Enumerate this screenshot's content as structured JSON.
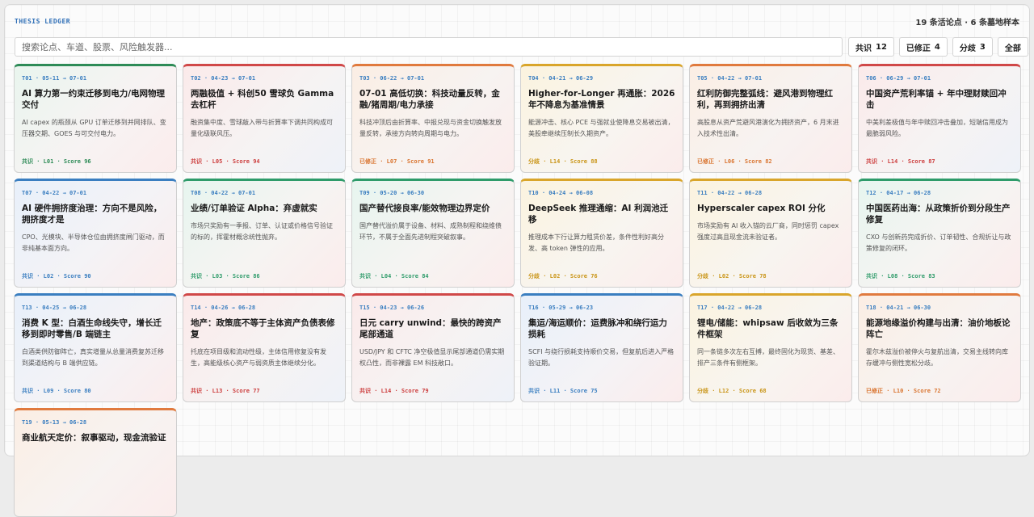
{
  "header": {
    "brand": "THESIS LEDGER",
    "stats": "19 条活论点 · 6 条墓地样本"
  },
  "search": {
    "placeholder": "搜索论点、车道、股票、风险触发器..."
  },
  "filters": [
    {
      "label": "共识",
      "count": "12"
    },
    {
      "label": "已修正",
      "count": "4"
    },
    {
      "label": "分歧",
      "count": "3"
    },
    {
      "label": "全部",
      "count": ""
    }
  ],
  "cards": [
    {
      "color": "green",
      "meta": "T01 · 05-11 → 07-01",
      "title": "AI 算力第一约束迁移到电力/电网物理交付",
      "desc": "AI capex 的瓶颈从 GPU 订单迁移到并网排队、变压器交期、GOES 与可交付电力。",
      "foot": "共识 · L01 · Score 96"
    },
    {
      "color": "red",
      "meta": "T02 · 04-23 → 07-01",
      "title": "两融极值 + 科创50 雪球负 Gamma 去杠杆",
      "desc": "融资集中度、雪球敲入带与折算率下调共同构成可量化级联风压。",
      "foot": "共识 · L05 · Score 94"
    },
    {
      "color": "orange",
      "meta": "T03 · 06-22 → 07-01",
      "title": "07-01 高低切换：科技动量反转，金融/猪周期/电力承接",
      "desc": "科技冲顶后由折算率、中报兑现与资金切换触发放量反转，承接方向转向周期与电力。",
      "foot": "已修正 · L07 · Score 91"
    },
    {
      "color": "yellow",
      "meta": "T04 · 04-21 → 06-29",
      "title": "Higher-for-Longer 再通胀：2026 年不降息为基准情景",
      "desc": "能源冲击、核心 PCE 与强就业使降息交易被出清，美股牵继续压制长久期资产。",
      "foot": "分歧 · L14 · Score 88"
    },
    {
      "color": "orange",
      "meta": "T05 · 04-22 → 07-01",
      "title": "红利防御完整弧线：避风港到物理红利，再到拥挤出清",
      "desc": "高股息从资产荒避风港演化为拥挤资产，6 月末进入技术性出清。",
      "foot": "已修正 · L06 · Score 82"
    },
    {
      "color": "red",
      "meta": "T06 · 06-29 → 07-01",
      "title": "中国资产荒利率锚 + 年中理财赎回冲击",
      "desc": "中美利差极值与年中赎回冲击叠加，短端信用成为最脆弱风险。",
      "foot": "共识 · L14 · Score 87"
    },
    {
      "color": "blue",
      "meta": "T07 · 04-22 → 07-01",
      "title": "AI 硬件拥挤度治理：方向不是风险，拥挤度才是",
      "desc": "CPO、光模块、半导体仓位由拥挤度闸门驱动，而非纯基本面方向。",
      "foot": "共识 · L02 · Score 90"
    },
    {
      "color": "teal",
      "meta": "T08 · 04-22 → 07-01",
      "title": "业绩/订单验证 Alpha：弃虚就实",
      "desc": "市场只奖励有一季报、订单、认证或价格信号验证的标的，挥霍材概念统性抛弃。",
      "foot": "共识 · L03 · Score 86"
    },
    {
      "color": "teal",
      "meta": "T09 · 05-20 → 06-30",
      "title": "国产替代接良率/能效物理边界定价",
      "desc": "国产替代溢价属于设备、材料、成熟制程和绕维债环节，不属于全面先进制程突破叙事。",
      "foot": "共识 · L04 · Score 84"
    },
    {
      "color": "yellow",
      "meta": "T10 · 04-24 → 06-08",
      "title": "DeepSeek 推理通缩：AI 利润池迁移",
      "desc": "推理成本下行让算力租赁价差，条件性利好高分发、高 token 弹性的应用。",
      "foot": "分歧 · L02 · Score 76"
    },
    {
      "color": "yellow",
      "meta": "T11 · 04-22 → 06-28",
      "title": "Hyperscaler capex ROI 分化",
      "desc": "市场奖励有 AI 收入锚的云厂商，同时惩罚 capex 强度过高且现金流未验证者。",
      "foot": "分歧 · L02 · Score 78"
    },
    {
      "color": "teal",
      "meta": "T12 · 04-17 → 06-28",
      "title": "中国医药出海：从政策折价到分段生产修复",
      "desc": "CXO 与创新药完成折价、订单韧性、合规折让与政策修复的闭环。",
      "foot": "共识 · L08 · Score 83"
    },
    {
      "color": "blue",
      "meta": "T13 · 04-25 → 06-28",
      "title": "消费 K 型：白酒生命线失守，增长迁移到即时零售/B 端链主",
      "desc": "白酒类供防御阵亡，真实增量从总量消费复苏迁移到渠道结构与 B 端供应链。",
      "foot": "共识 · L09 · Score 80"
    },
    {
      "color": "red",
      "meta": "T14 · 04-26 → 06-28",
      "title": "地产：政策底不等于主体资产负债表修复",
      "desc": "托底在项目级和流动性级，主体信用修复没有发生，高能级核心资产与弱资质主体继续分化。",
      "foot": "共识 · L13 · Score 77"
    },
    {
      "color": "red",
      "meta": "T15 · 04-23 → 06-26",
      "title": "日元 carry unwind：最快的跨资产尾部通道",
      "desc": "USD/JPY 和 CFTC 净空极值显示尾部通道仍需实期权凸性，而非裸露 EM 科技敞口。",
      "foot": "共识 · L14 · Score 79"
    },
    {
      "color": "blue",
      "meta": "T16 · 05-29 → 06-23",
      "title": "集运/海运顺价：运费脉冲和绕行运力损耗",
      "desc": "SCFI 与绕行损耗支持顺价交易，但复航后进入严格验证期。",
      "foot": "共识 · L11 · Score 75"
    },
    {
      "color": "yellow",
      "meta": "T17 · 04-22 → 06-28",
      "title": "锂电/储能：whipsaw 后收敛为三条件框架",
      "desc": "同一条链多次左右互搏，最终固化为现货、基差、排产三条件有侧框架。",
      "foot": "分歧 · L12 · Score 68"
    },
    {
      "color": "orange",
      "meta": "T18 · 04-21 → 06-30",
      "title": "能源地缘溢价构建与出清：油价地板论阵亡",
      "desc": "霍尔木兹溢价被停火与复航出清，交易主线转向库存缓冲与侧性宽松分歧。",
      "foot": "已修正 · L10 · Score 72"
    },
    {
      "color": "orange",
      "meta": "T19 · 05-13 → 06-28",
      "title": "商业航天定价：叙事驱动，现金流验证",
      "desc": "",
      "foot": ""
    }
  ]
}
